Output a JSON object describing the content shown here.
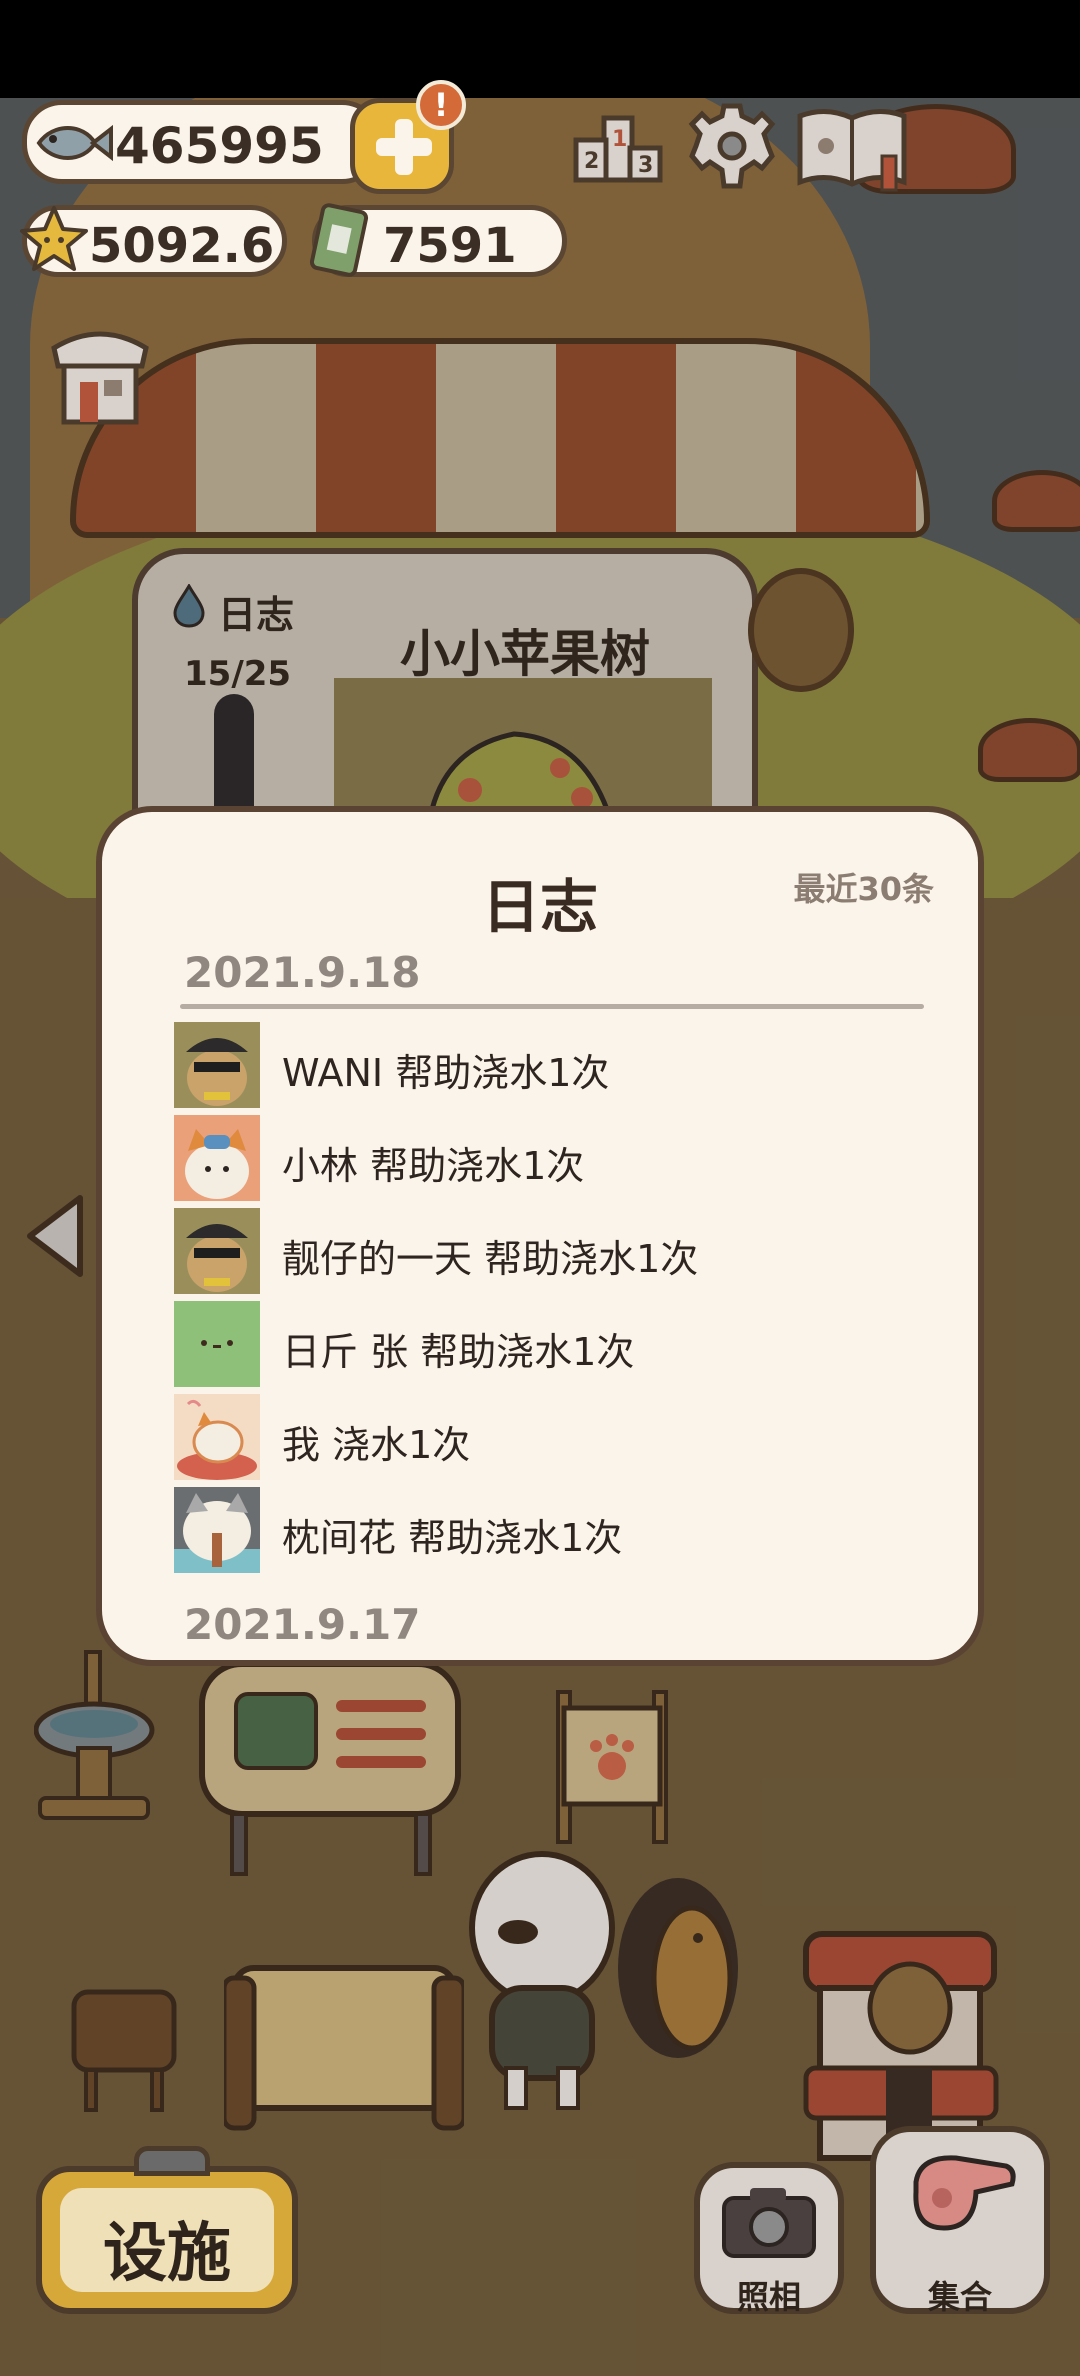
{
  "hud": {
    "fish_count": "465995",
    "star_count": "5092.6",
    "ticket_count": "7591",
    "alert_mark": "!"
  },
  "tree_card": {
    "log_label": "日志",
    "water_progress": "15/25",
    "tree_name": "小小苹果树"
  },
  "log_dialog": {
    "title": "日志",
    "recent_label": "最近30条",
    "groups": [
      {
        "date": "2021.9.18",
        "entries": [
          {
            "text": "WANI 帮助浇水1次"
          },
          {
            "text": "小林 帮助浇水1次"
          },
          {
            "text": "靓仔的一天 帮助浇水1次"
          },
          {
            "text": "日斤 张 帮助浇水1次"
          },
          {
            "text": "我 浇水1次"
          },
          {
            "text": "枕间花 帮助浇水1次"
          }
        ]
      },
      {
        "date": "2021.9.17",
        "entries": []
      }
    ]
  },
  "bottom_bar": {
    "facility_label": "设施",
    "photo_label": "照相",
    "gather_label": "集合"
  }
}
